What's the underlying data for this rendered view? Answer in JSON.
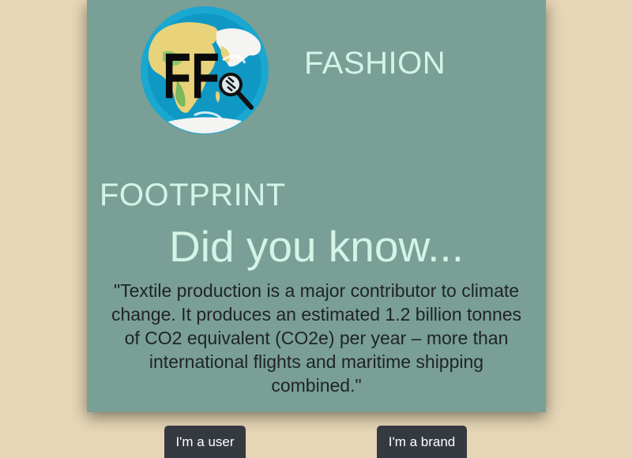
{
  "header": {
    "logo_letters": "FF",
    "title_line1": "FASHION",
    "title_line2": "FOOTPRINT"
  },
  "main": {
    "heading": "Did you know...",
    "fact": "\"Textile production is a major contributor to climate change. It produces an estimated 1.2 billion tonnes of CO2 equivalent (CO2e) per year – more than international flights and maritime shipping combined.\""
  },
  "actions": {
    "user_label": "I'm a user",
    "brand_label": "I'm a brand"
  },
  "colors": {
    "page_background": "#e6d6b6",
    "card_background": "#7a9f96",
    "title_text": "#d4f4e6",
    "button_background": "#343a40"
  },
  "icons": {
    "logo": "globe-logo-icon",
    "magnifier": "magnifying-glass-icon"
  }
}
